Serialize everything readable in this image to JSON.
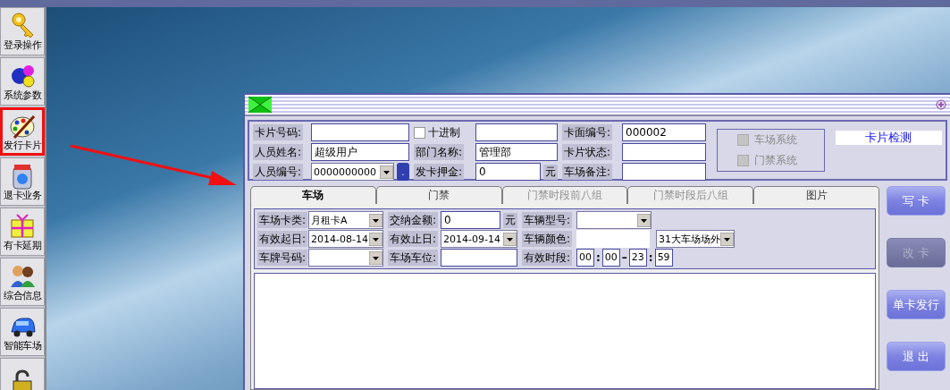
{
  "sidebar": {
    "items": [
      {
        "label": "登录操作",
        "selected": false
      },
      {
        "label": "系统参数",
        "selected": false
      },
      {
        "label": "发行卡片",
        "selected": true
      },
      {
        "label": "退卡业务",
        "selected": false
      },
      {
        "label": "有卡延期",
        "selected": false
      },
      {
        "label": "综合信息",
        "selected": false
      },
      {
        "label": "智能车场",
        "selected": false
      },
      {
        "selected": false
      }
    ]
  },
  "dialog": {
    "header": {
      "rows": [
        {
          "cells": [
            {
              "kind": "label",
              "text": "卡片号码:"
            },
            {
              "kind": "text"
            },
            {
              "kind": "checkbox",
              "text": "十进制",
              "checked": false
            },
            {
              "kind": "text"
            },
            {
              "kind": "label",
              "text": "卡面编号:"
            },
            {
              "kind": "text",
              "value": "000002"
            }
          ]
        },
        {
          "cells": [
            {
              "kind": "label",
              "text": "人员姓名:"
            },
            {
              "kind": "text",
              "value": "超级用户"
            },
            {
              "kind": "label",
              "text": "部门名称:"
            },
            {
              "kind": "text",
              "value": "管理部"
            },
            {
              "kind": "label",
              "text": "卡片状态:"
            },
            {
              "kind": "text"
            }
          ]
        },
        {
          "cells": [
            {
              "kind": "label",
              "text": "人员编号:"
            },
            {
              "kind": "combo",
              "value": "0000000000",
              "button": "."
            },
            {
              "kind": "label",
              "text": "发卡押金:"
            },
            {
              "kind": "text",
              "value": "0",
              "unit": "元"
            },
            {
              "kind": "label",
              "text": "车场备注:"
            },
            {
              "kind": "text"
            }
          ]
        }
      ],
      "systems": [
        {
          "label": "车场系统",
          "checked": false,
          "disabled": true
        },
        {
          "label": "门禁系统",
          "checked": false,
          "disabled": true
        }
      ],
      "card_check": "卡片检测"
    },
    "tabs": [
      {
        "label": "车场",
        "selected": true,
        "disabled": false
      },
      {
        "label": "门禁",
        "selected": false,
        "disabled": false
      },
      {
        "label": "门禁时段前八组",
        "selected": false,
        "disabled": true
      },
      {
        "label": "门禁时段后八组",
        "selected": false,
        "disabled": true
      },
      {
        "label": "图片",
        "selected": false,
        "disabled": false
      }
    ],
    "content": {
      "rows": [
        {
          "cells": [
            {
              "kind": "label",
              "text": "车场卡类:"
            },
            {
              "kind": "combo",
              "value": "月租卡A"
            },
            {
              "kind": "label",
              "text": "交纳金额:"
            },
            {
              "kind": "text",
              "value": "0",
              "unit": "元"
            },
            {
              "kind": "label",
              "text": "车辆型号:"
            },
            {
              "kind": "combo"
            }
          ]
        },
        {
          "cells": [
            {
              "kind": "label",
              "text": "有效起日:"
            },
            {
              "kind": "combo",
              "value": "2014-08-14"
            },
            {
              "kind": "label",
              "text": "有效止日:"
            },
            {
              "kind": "combo",
              "value": "2014-09-14"
            },
            {
              "kind": "label",
              "text": "车辆颜色:"
            },
            {
              "kind": "plain"
            },
            {
              "kind": "combo",
              "value": "31大车场场外"
            }
          ]
        },
        {
          "cells": [
            {
              "kind": "label",
              "text": "车牌号码:"
            },
            {
              "kind": "combo"
            },
            {
              "kind": "label",
              "text": "车场车位:"
            },
            {
              "kind": "text"
            },
            {
              "kind": "label",
              "text": "有效时段:"
            },
            {
              "kind": "time",
              "parts": [
                {
                  "kind": "field",
                  "text": "00"
                },
                {
                  "kind": "sep",
                  "text": ":"
                },
                {
                  "kind": "field",
                  "text": "00"
                },
                {
                  "kind": "sep",
                  "text": "–"
                },
                {
                  "kind": "field",
                  "text": "23"
                },
                {
                  "kind": "sep",
                  "text": ":"
                },
                {
                  "kind": "field",
                  "text": "59"
                }
              ]
            }
          ]
        }
      ]
    },
    "buttons": [
      {
        "label": "写 卡",
        "disabled": false
      },
      {
        "label": "改 卡",
        "disabled": true
      },
      {
        "label": "单卡发行",
        "disabled": false
      },
      {
        "label": "退 出",
        "disabled": false
      }
    ]
  }
}
